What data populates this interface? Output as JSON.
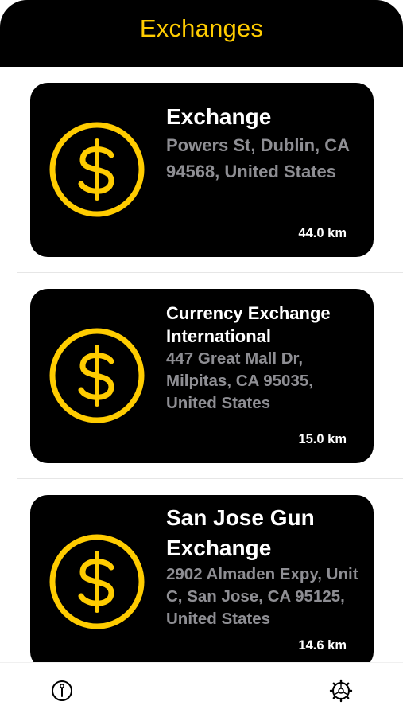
{
  "header": {
    "title": "Exchanges"
  },
  "exchanges": [
    {
      "name": "Exchange",
      "address": "Powers St, Dublin, CA  94568, United States",
      "distance": "44.0 km",
      "icon": "dollar-coin-icon"
    },
    {
      "name": "Currency Exchange International",
      "address": "447 Great Mall Dr, Milpitas, CA  95035, United States",
      "distance": "15.0 km",
      "icon": "dollar-coin-icon"
    },
    {
      "name": "San Jose Gun Exchange",
      "address": "2902 Almaden Expy, Unit C, San Jose, CA 95125, United States",
      "distance": "14.6 km",
      "icon": "dollar-coin-icon"
    }
  ],
  "tabbar": {
    "left_icon": "info-icon",
    "right_icon": "settings-gear-icon"
  },
  "colors": {
    "accent": "#ffcc00",
    "card": "#000000",
    "secondary_text": "#8e8e93"
  }
}
